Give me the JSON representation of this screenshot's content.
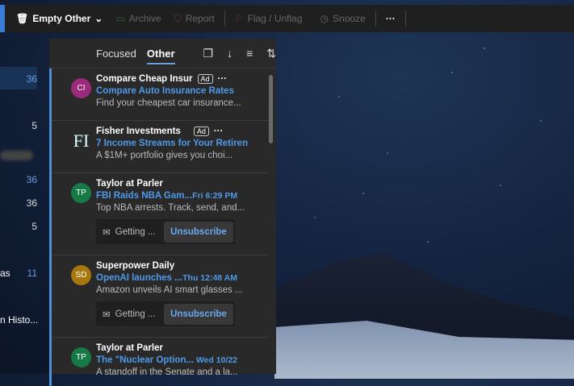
{
  "toolbar": {
    "empty": "Empty Other",
    "archive": "Archive",
    "report": "Report",
    "flag": "Flag / Unflag",
    "snooze": "Snooze",
    "more": "···"
  },
  "sidebar": {
    "counts": [
      "36",
      "5",
      "36",
      "36",
      "5",
      "11"
    ],
    "partial_labels": [
      "as",
      "n Histo..."
    ]
  },
  "list": {
    "tabs": {
      "focused": "Focused",
      "other": "Other"
    },
    "items": [
      {
        "initials": "CI",
        "color": "#9b2a7a",
        "from": "Compare Cheap Insur",
        "ad": "Ad",
        "subject": "Compare Auto Insurance Rates",
        "time": "",
        "preview": "Find your cheapest car insurance..."
      },
      {
        "initials": "FI",
        "color": "#1f4a3a",
        "from": "Fisher Investments",
        "ad": "Ad",
        "subject": "7 Income Streams for Your Retiren",
        "time": "",
        "preview": "A $1M+ portfolio gives you choi..."
      },
      {
        "initials": "TP",
        "color": "#157a45",
        "from": "Taylor at Parler",
        "subject": "FBI Raids NBA Gam...",
        "time": "Fri 6:29 PM",
        "preview": "Top NBA arrests. Track, send, and...",
        "unsub_text": "Getting ...",
        "unsub": "Unsubscribe"
      },
      {
        "initials": "SD",
        "color": "#a8770d",
        "from": "Superpower Daily",
        "subject": "OpenAI launches ...",
        "time": "Thu 12:48 AM",
        "preview": "Amazon unveils AI smart glasses ...",
        "unsub_text": "Getting ...",
        "unsub": "Unsubscribe"
      },
      {
        "initials": "TP",
        "color": "#157a45",
        "from": "Taylor at Parler",
        "subject": "The \"Nuclear Option...",
        "time": "Wed 10/22",
        "preview": "A standoff in the Senate and a la..."
      }
    ]
  }
}
